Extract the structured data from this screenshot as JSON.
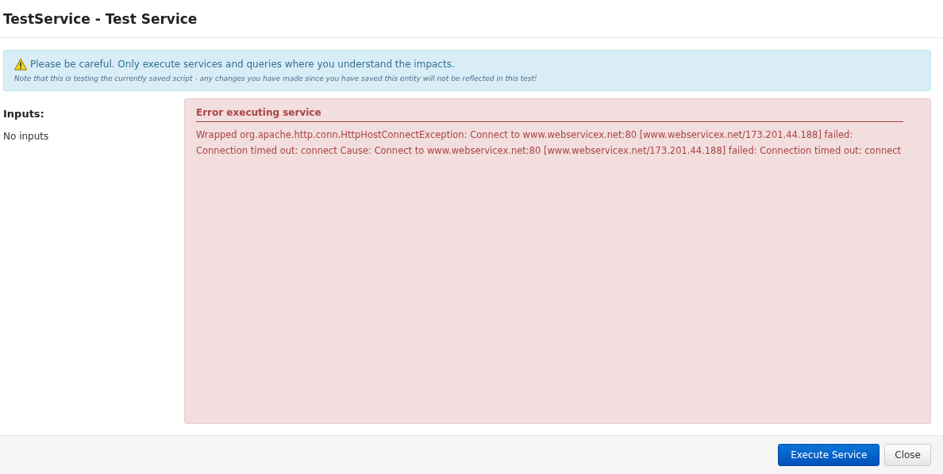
{
  "dialog": {
    "title": "TestService - Test Service"
  },
  "alert": {
    "message": "Please be careful. Only execute services and queries where you understand the impacts.",
    "note": "Note that this is testing the currently saved script - any changes you have made since you have saved this entity will not be reflected in this test!"
  },
  "inputs": {
    "heading": "Inputs:",
    "empty_text": "No inputs"
  },
  "error": {
    "title": "Error executing service",
    "message": "Wrapped org.apache.http.conn.HttpHostConnectException: Connect to www.webservicex.net:80 [www.webservicex.net/173.201.44.188] failed: Connection timed out: connect Cause: Connect to www.webservicex.net:80 [www.webservicex.net/173.201.44.188] failed: Connection timed out: connect"
  },
  "buttons": [
    {
      "label": "Execute Service",
      "kind": "primary"
    },
    {
      "label": "Close",
      "kind": "default"
    }
  ]
}
